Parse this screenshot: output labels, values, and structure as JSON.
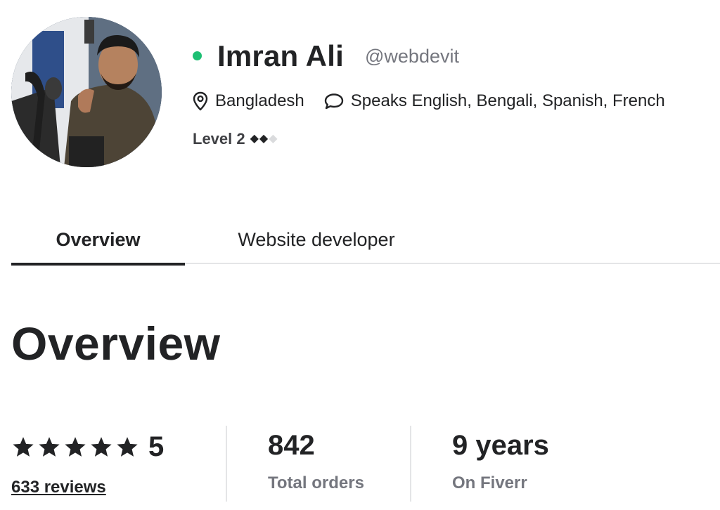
{
  "profile": {
    "name": "Imran Ali",
    "handle": "@webdevit",
    "online_color": "#1dbf73",
    "location": "Bangladesh",
    "languages": "Speaks English, Bengali, Spanish, French",
    "level_label": "Level 2",
    "level_filled": 2,
    "level_total": 3,
    "icons": {
      "location": "map-pin-icon",
      "languages": "speech-bubble-icon"
    }
  },
  "tabs": [
    {
      "label": "Overview",
      "active": true
    },
    {
      "label": "Website developer",
      "active": false
    }
  ],
  "overview": {
    "title": "Overview",
    "rating": {
      "stars": 5,
      "value": "5",
      "reviews": "633 reviews"
    },
    "orders": {
      "value": "842",
      "label": "Total orders"
    },
    "tenure": {
      "value": "9 years",
      "label": "On Fiverr"
    }
  },
  "colors": {
    "text": "#222325",
    "muted": "#74767e",
    "divider": "#e4e5e7",
    "accent": "#1dbf73"
  }
}
